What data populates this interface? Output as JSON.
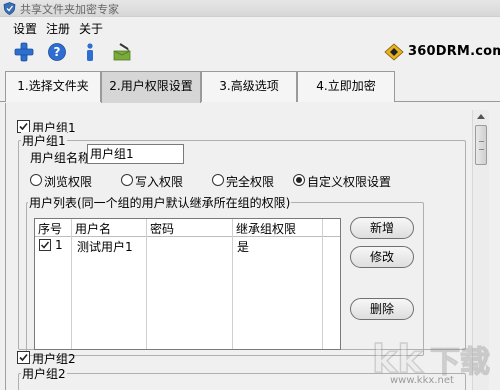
{
  "window": {
    "title": "共享文件夹加密专家"
  },
  "menu": {
    "items": [
      "设置",
      "注册",
      "关于"
    ]
  },
  "toolbar": {
    "icons": [
      "add-icon",
      "help-icon",
      "info-icon",
      "register-icon"
    ]
  },
  "brand": {
    "text": "360DRM.com"
  },
  "tabs": [
    {
      "label": "1.选择文件夹",
      "active": false
    },
    {
      "label": "2.用户权限设置",
      "active": true
    },
    {
      "label": "3.高级选项",
      "active": false
    },
    {
      "label": "4.立即加密",
      "active": false
    }
  ],
  "group1": {
    "checkbox_label": "用户组1",
    "checked": true,
    "frame_title": "用户组1",
    "name_label": "用户组名称",
    "name_value": "用户组1",
    "permissions": [
      {
        "label": "浏览权限",
        "selected": false
      },
      {
        "label": "写入权限",
        "selected": false
      },
      {
        "label": "完全权限",
        "selected": false
      },
      {
        "label": "自定义权限设置",
        "selected": true
      }
    ],
    "user_list_title": "用户列表(同一个组的用户默认继承所在组的权限)",
    "columns": [
      "序号",
      "用户名",
      "密码",
      "继承组权限"
    ],
    "rows": [
      {
        "index": "1",
        "checked": true,
        "username": "测试用户1",
        "password": "",
        "inherit": "是"
      }
    ],
    "buttons": {
      "add": "新增",
      "edit": "修改",
      "delete": "删除"
    }
  },
  "group2": {
    "checkbox_label": "用户组2",
    "checked": true,
    "frame_title": "用户组2"
  },
  "watermark": {
    "text": "kk下载",
    "url": "www.kkx.net"
  }
}
